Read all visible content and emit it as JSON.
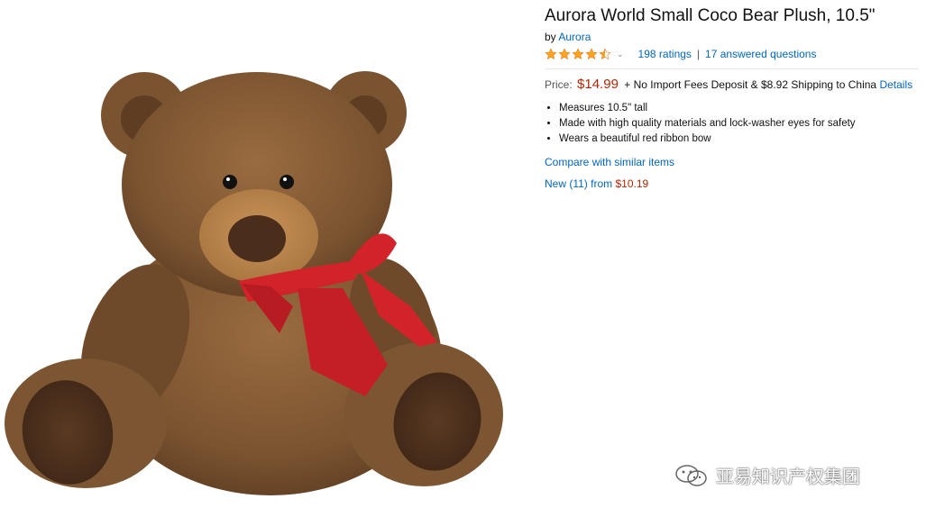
{
  "product": {
    "title": "Aurora World Small Coco Bear Plush, 10.5\"",
    "by_label": "by",
    "brand": "Aurora",
    "rating": 4.5,
    "ratings_count": "198 ratings",
    "separator": "|",
    "answered_questions": "17 answered questions",
    "price_label": "Price:",
    "price": "$14.99",
    "shipping_note": "+ No Import Fees Deposit & $8.92 Shipping to China",
    "details_link": "Details",
    "bullets": [
      "Measures 10.5\" tall",
      "Made with high quality materials and lock-washer eyes for safety",
      "Wears a beautiful red ribbon bow"
    ],
    "compare_link": "Compare with similar items",
    "offers_prefix": "New (11) from",
    "offers_price": "$10.19"
  },
  "image": {
    "icon": "teddy-bear-photo"
  },
  "watermark": {
    "text": "亚易知识产权集团",
    "icon": "wechat-icon"
  },
  "colors": {
    "link": "#0066c0",
    "price": "#b12704",
    "star": "#ffa41c",
    "bear_fur": "#7a5330",
    "ribbon": "#d2232a"
  }
}
